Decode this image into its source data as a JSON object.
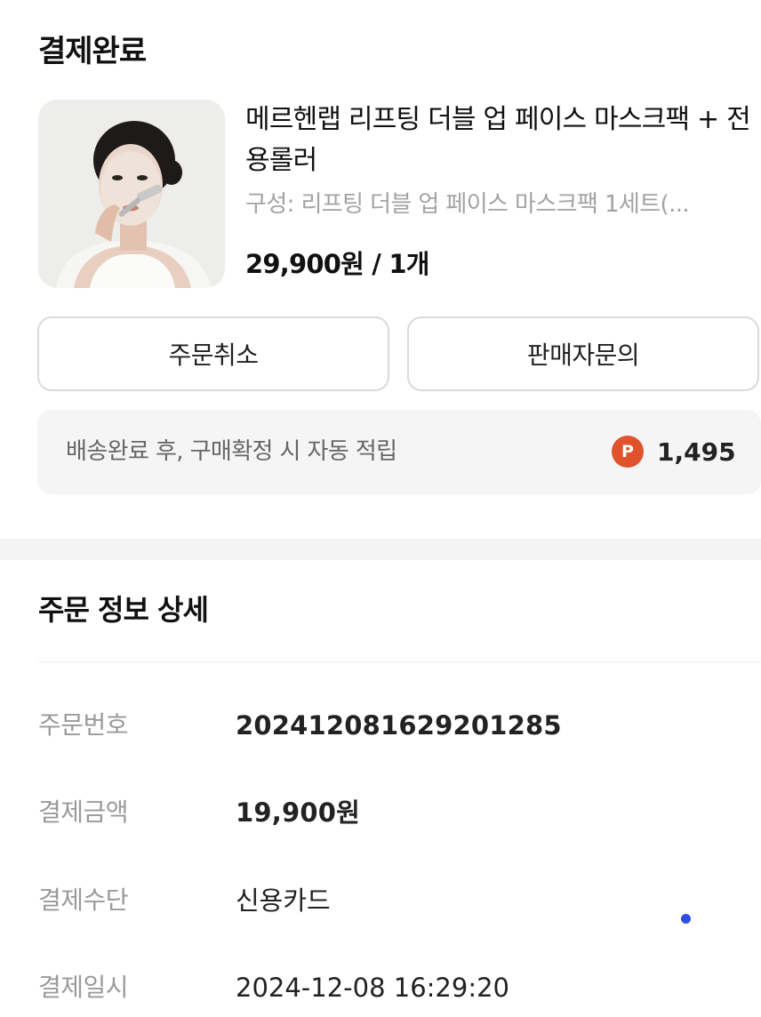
{
  "header": {
    "title": "결제완료"
  },
  "product": {
    "name": "메르헨랩 리프팅 더블 업 페이스 마스크팩 + 전용롤러",
    "option": "구성: 리프팅 더블 업 페이스 마스크팩 1세트(...",
    "price_qty": "29,900원 / 1개"
  },
  "actions": {
    "cancel_label": "주문취소",
    "inquiry_label": "판매자문의"
  },
  "points": {
    "text": "배송완료 후, 구매확정 시 자동 적립",
    "badge": "P",
    "value": "1,495",
    "badge_color": "#e0532c"
  },
  "order_detail": {
    "title": "주문 정보 상세",
    "rows": [
      {
        "label": "주문번호",
        "value": "20241208162920 1285"
      },
      {
        "label": "결제금액",
        "value": "19,900원"
      },
      {
        "label": "결제수단",
        "value": "신용카드"
      },
      {
        "label": "결제일시",
        "value": "2024-12-08 16:29:20"
      }
    ]
  },
  "colors": {
    "accent_dot": "#2f4fe0",
    "muted_text": "#9a9a9a",
    "surface": "#f5f5f6"
  }
}
